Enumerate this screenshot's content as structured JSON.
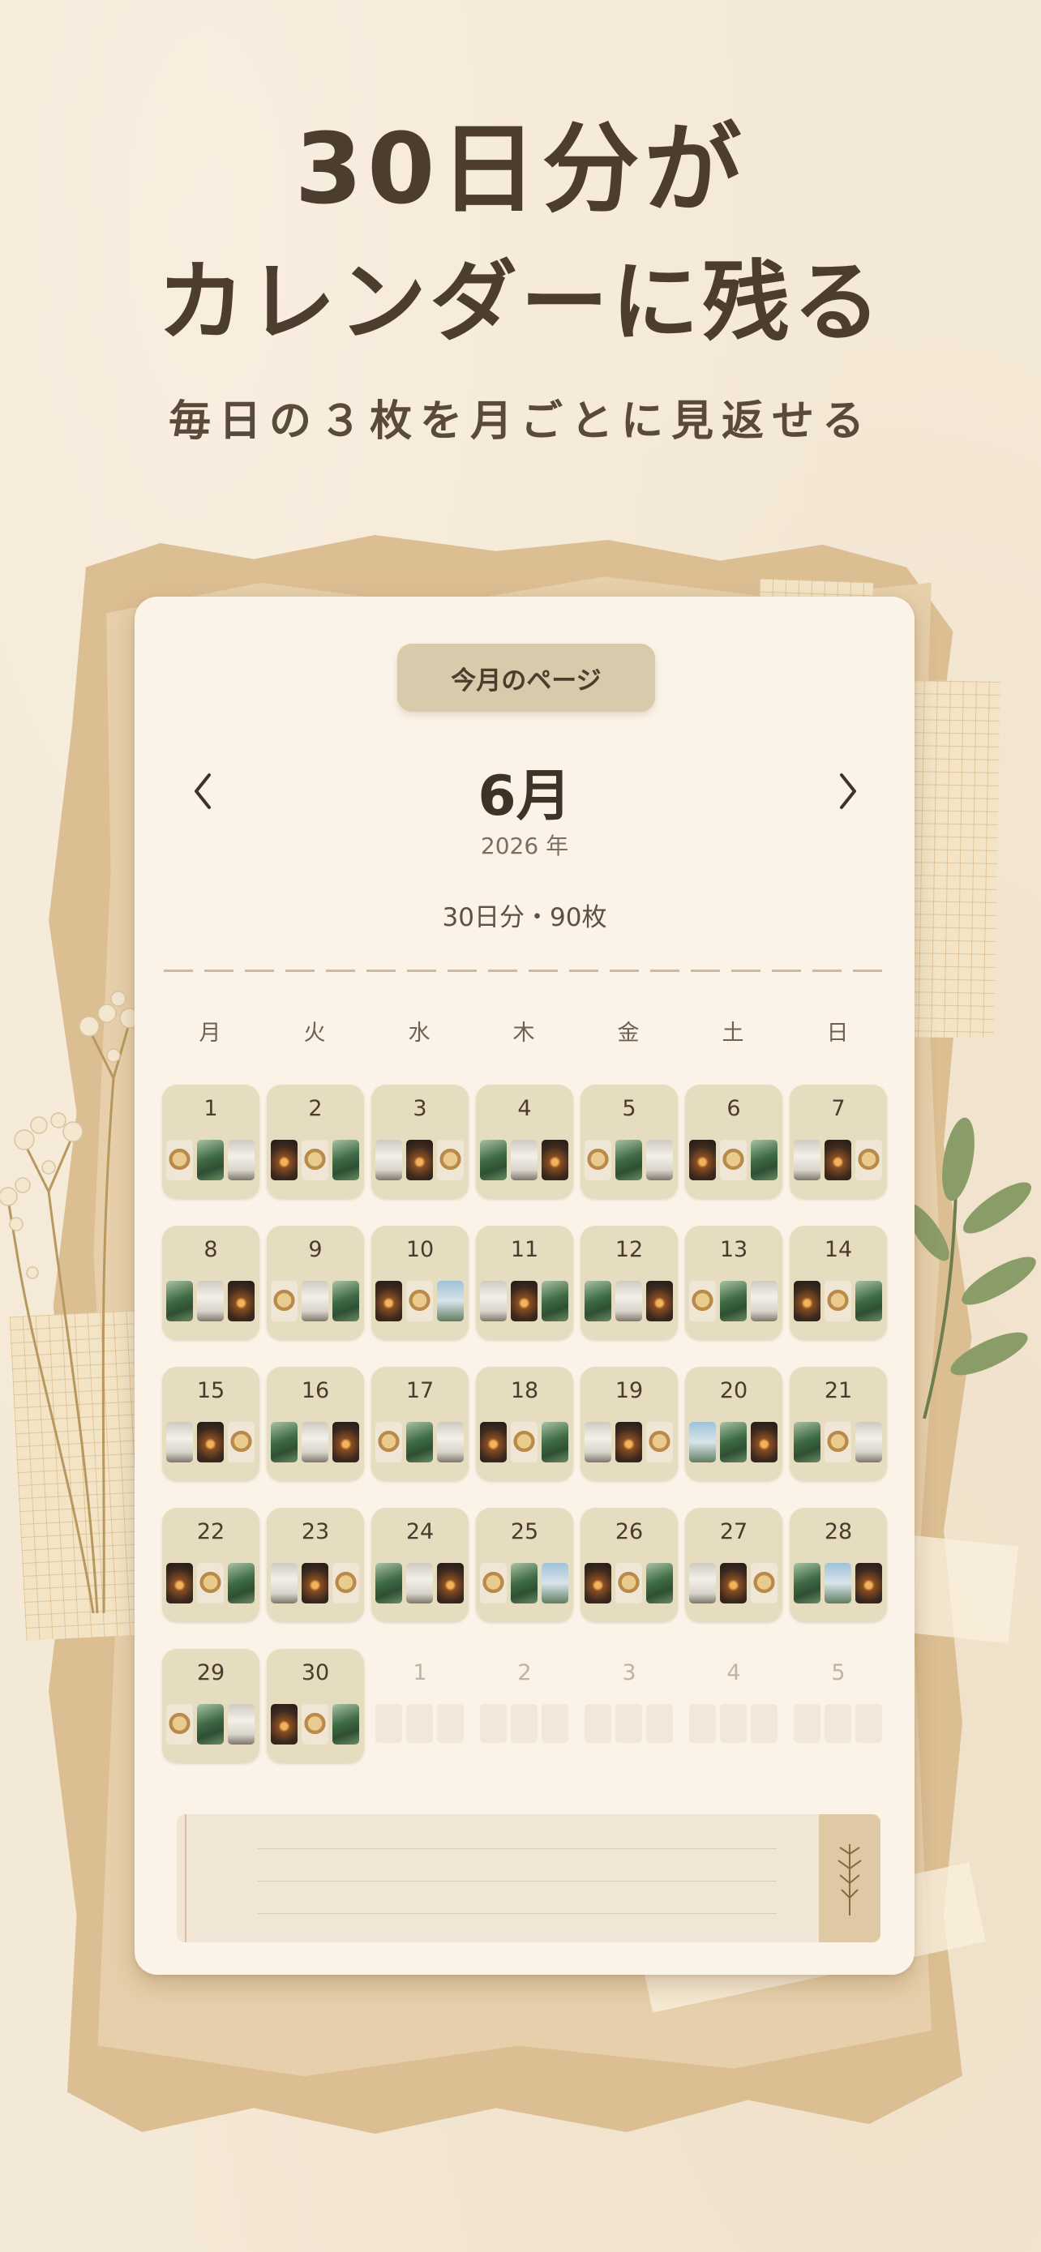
{
  "hero": {
    "line1": "30日分が",
    "line2": "カレンダーに残る",
    "subtitle": "毎日の３枚を月ごとに見返せる"
  },
  "calendar": {
    "page_button": "今月のページ",
    "month": "6月",
    "year": "2026 年",
    "summary": "30日分・90枚",
    "prev_icon": "chevron-left-icon",
    "next_icon": "chevron-right-icon",
    "weekdays": [
      "月",
      "火",
      "水",
      "木",
      "金",
      "土",
      "日"
    ],
    "days": [
      {
        "day": "1",
        "photos": [
          "coffee",
          "plant",
          "cup"
        ]
      },
      {
        "day": "2",
        "photos": [
          "candle",
          "coffee",
          "plant"
        ]
      },
      {
        "day": "3",
        "photos": [
          "cup",
          "candle",
          "coffee"
        ]
      },
      {
        "day": "4",
        "photos": [
          "plant",
          "cup",
          "candle"
        ]
      },
      {
        "day": "5",
        "photos": [
          "coffee",
          "plant",
          "cup"
        ]
      },
      {
        "day": "6",
        "photos": [
          "candle",
          "coffee",
          "plant"
        ]
      },
      {
        "day": "7",
        "photos": [
          "cup",
          "candle",
          "coffee"
        ]
      },
      {
        "day": "8",
        "photos": [
          "plant",
          "cup",
          "candle"
        ]
      },
      {
        "day": "9",
        "photos": [
          "coffee",
          "cup",
          "plant"
        ]
      },
      {
        "day": "10",
        "photos": [
          "candle",
          "coffee",
          "sky"
        ]
      },
      {
        "day": "11",
        "photos": [
          "cup",
          "candle",
          "plant"
        ]
      },
      {
        "day": "12",
        "photos": [
          "plant",
          "cup",
          "candle"
        ]
      },
      {
        "day": "13",
        "photos": [
          "coffee",
          "plant",
          "cup"
        ]
      },
      {
        "day": "14",
        "photos": [
          "candle",
          "coffee",
          "plant"
        ]
      },
      {
        "day": "15",
        "photos": [
          "cup",
          "candle",
          "coffee"
        ]
      },
      {
        "day": "16",
        "photos": [
          "plant",
          "cup",
          "candle"
        ]
      },
      {
        "day": "17",
        "photos": [
          "coffee",
          "plant",
          "cup"
        ]
      },
      {
        "day": "18",
        "photos": [
          "candle",
          "coffee",
          "plant"
        ]
      },
      {
        "day": "19",
        "photos": [
          "cup",
          "candle",
          "coffee"
        ]
      },
      {
        "day": "20",
        "photos": [
          "sky",
          "plant",
          "candle"
        ]
      },
      {
        "day": "21",
        "photos": [
          "plant",
          "coffee",
          "cup"
        ]
      },
      {
        "day": "22",
        "photos": [
          "candle",
          "coffee",
          "plant"
        ]
      },
      {
        "day": "23",
        "photos": [
          "cup",
          "candle",
          "coffee"
        ]
      },
      {
        "day": "24",
        "photos": [
          "plant",
          "cup",
          "candle"
        ]
      },
      {
        "day": "25",
        "photos": [
          "coffee",
          "plant",
          "sky"
        ]
      },
      {
        "day": "26",
        "photos": [
          "candle",
          "coffee",
          "plant"
        ]
      },
      {
        "day": "27",
        "photos": [
          "cup",
          "candle",
          "coffee"
        ]
      },
      {
        "day": "28",
        "photos": [
          "plant",
          "sky",
          "candle"
        ]
      },
      {
        "day": "29",
        "photos": [
          "coffee",
          "plant",
          "cup"
        ]
      },
      {
        "day": "30",
        "photos": [
          "candle",
          "coffee",
          "plant"
        ]
      }
    ],
    "next_month_days": [
      "1",
      "2",
      "3",
      "4",
      "5"
    ]
  },
  "decor": {
    "sprig_icon": "leaf-sprig-icon",
    "flower_icon": "dried-flower-icon",
    "leaf_icon": "eucalyptus-leaf-icon"
  }
}
